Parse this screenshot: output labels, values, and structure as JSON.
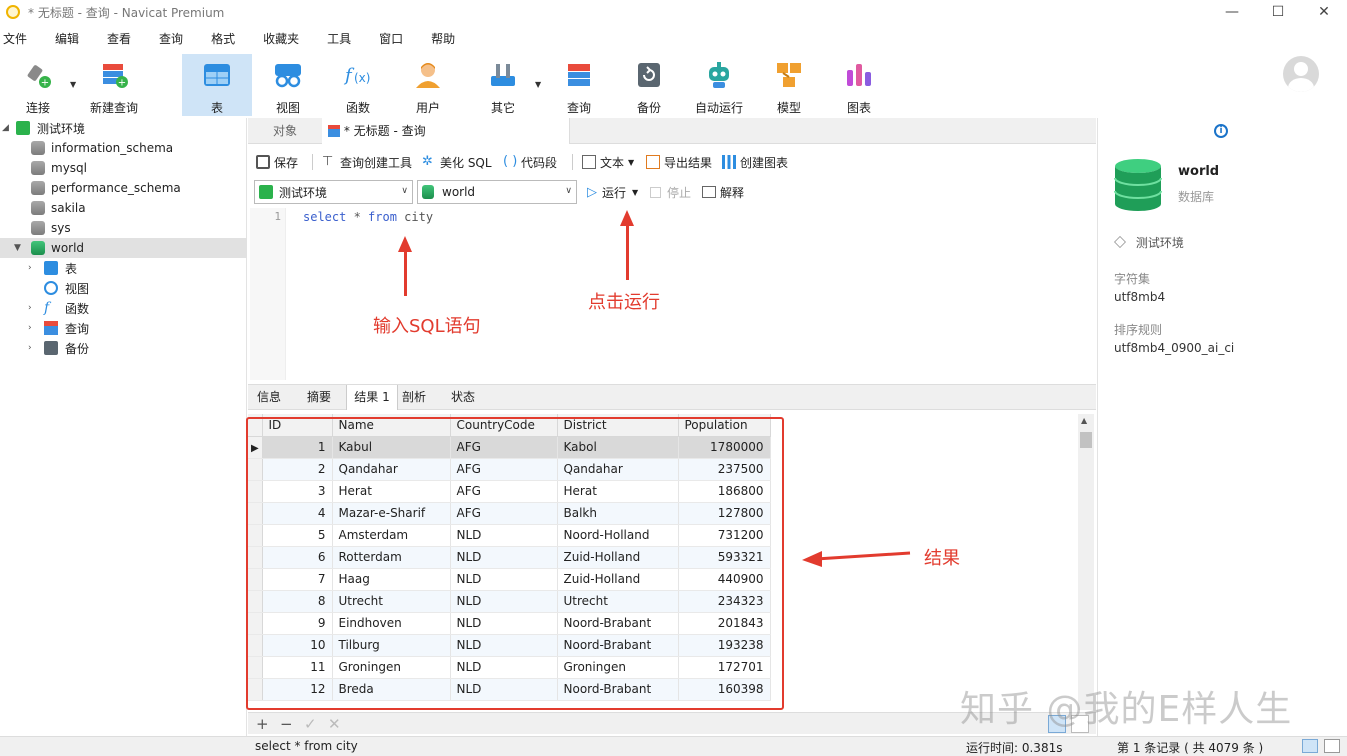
{
  "window": {
    "title": "* 无标题 - 查询 - Navicat Premium",
    "minimize": "—",
    "maximize": "☐",
    "close": "✕"
  },
  "menu": [
    "文件",
    "编辑",
    "查看",
    "查询",
    "格式",
    "收藏夹",
    "工具",
    "窗口",
    "帮助"
  ],
  "toolbar": {
    "connect": "连接",
    "new_query": "新建查询",
    "table": "表",
    "view": "视图",
    "function": "函数",
    "user": "用户",
    "other": "其它",
    "query": "查询",
    "backup": "备份",
    "auto_run": "自动运行",
    "model": "模型",
    "chart": "图表"
  },
  "tree": {
    "connection": "测试环境",
    "databases": [
      "information_schema",
      "mysql",
      "performance_schema",
      "sakila",
      "sys",
      "world"
    ],
    "world_children": [
      "表",
      "视图",
      "函数",
      "查询",
      "备份"
    ]
  },
  "tabs": {
    "objects": "对象",
    "query": "* 无标题 - 查询"
  },
  "query_toolbar": {
    "save": "保存",
    "builder": "查询创建工具",
    "beautify": "美化 SQL",
    "snippet": "代码段",
    "text": "文本",
    "export": "导出结果",
    "create_chart": "创建图表",
    "run": "运行",
    "stop": "停止",
    "explain": "解释"
  },
  "selectors": {
    "connection": "测试环境",
    "database": "world"
  },
  "editor": {
    "line": "1",
    "kw1": "select",
    "mid": " * ",
    "kw2": "from",
    "rest": " city"
  },
  "annotations": {
    "input_sql": "输入SQL语句",
    "click_run": "点击运行",
    "result": "结果"
  },
  "result_tabs": [
    "信息",
    "摘要",
    "结果 1",
    "剖析",
    "状态"
  ],
  "grid": {
    "columns": [
      "ID",
      "Name",
      "CountryCode",
      "District",
      "Population"
    ],
    "rows": [
      [
        "1",
        "Kabul",
        "AFG",
        "Kabol",
        "1780000"
      ],
      [
        "2",
        "Qandahar",
        "AFG",
        "Qandahar",
        "237500"
      ],
      [
        "3",
        "Herat",
        "AFG",
        "Herat",
        "186800"
      ],
      [
        "4",
        "Mazar-e-Sharif",
        "AFG",
        "Balkh",
        "127800"
      ],
      [
        "5",
        "Amsterdam",
        "NLD",
        "Noord-Holland",
        "731200"
      ],
      [
        "6",
        "Rotterdam",
        "NLD",
        "Zuid-Holland",
        "593321"
      ],
      [
        "7",
        "Haag",
        "NLD",
        "Zuid-Holland",
        "440900"
      ],
      [
        "8",
        "Utrecht",
        "NLD",
        "Utrecht",
        "234323"
      ],
      [
        "9",
        "Eindhoven",
        "NLD",
        "Noord-Brabant",
        "201843"
      ],
      [
        "10",
        "Tilburg",
        "NLD",
        "Noord-Brabant",
        "193238"
      ],
      [
        "11",
        "Groningen",
        "NLD",
        "Groningen",
        "172701"
      ],
      [
        "12",
        "Breda",
        "NLD",
        "Noord-Brabant",
        "160398"
      ]
    ]
  },
  "grid_footer": {
    "add": "+",
    "remove": "−",
    "apply": "✓",
    "discard": "✕"
  },
  "status": {
    "sql": "select * from city",
    "runtime": "运行时间: 0.381s",
    "records": "第 1 条记录 ( 共 4079 条 )"
  },
  "info": {
    "name": "world",
    "type": "数据库",
    "connection": "测试环境",
    "charset_label": "字符集",
    "charset": "utf8mb4",
    "collation_label": "排序规则",
    "collation": "utf8mb4_0900_ai_ci"
  },
  "watermark": "知乎 @我的E样人生"
}
